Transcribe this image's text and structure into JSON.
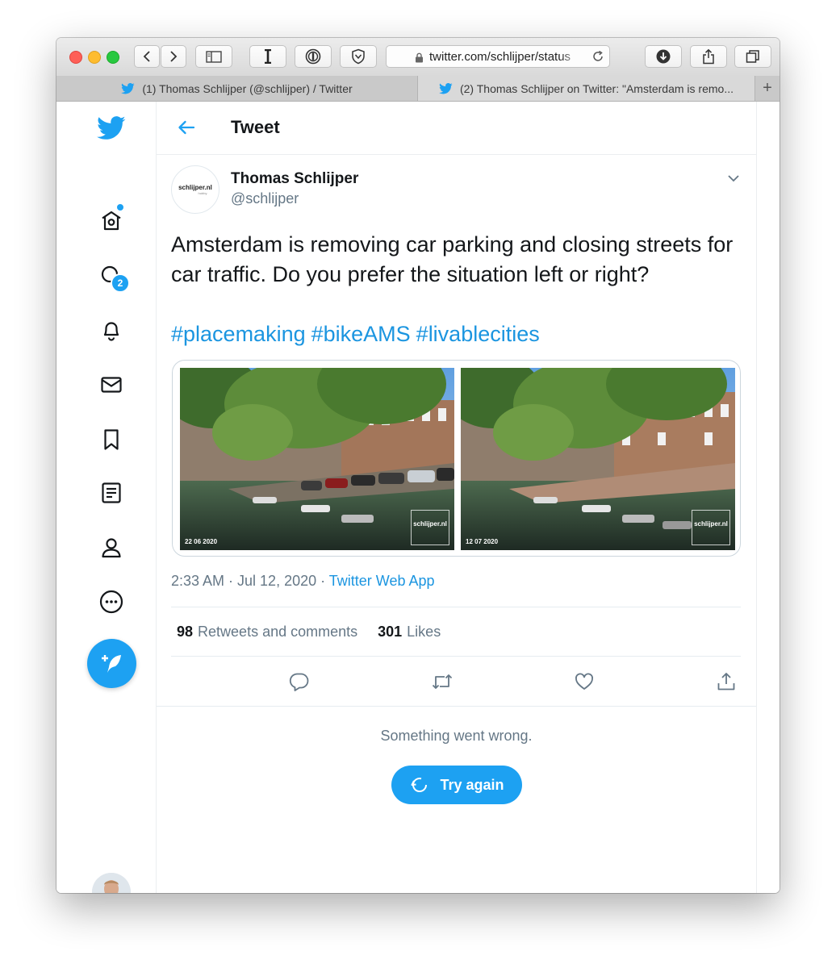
{
  "browser": {
    "url": "twitter.com/schlijper/status",
    "tabs": [
      {
        "label": "(1) Thomas Schlijper (@schlijper) / Twitter"
      },
      {
        "label": "(2) Thomas Schlijper on Twitter: \"Amsterdam is remo..."
      }
    ],
    "new_tab": "+"
  },
  "sidebar": {
    "notifications_count": "2",
    "icons": [
      "twitter-logo",
      "home",
      "explore",
      "notifications",
      "messages",
      "bookmarks",
      "lists",
      "profile",
      "more"
    ]
  },
  "header": {
    "title": "Tweet"
  },
  "tweet": {
    "author_name": "Thomas Schlijper",
    "author_handle": "@schlijper",
    "profile_logo": "schlijper.nl",
    "profile_logo_sub": "hobby",
    "text": "Amsterdam is removing car parking and closing streets for car traffic. Do you prefer the situation left or right?",
    "hashtags": [
      "#placemaking",
      "#bikeAMS",
      "#livablecities"
    ],
    "photos": [
      {
        "date": "22 06 2020",
        "watermark": "schlijper.nl"
      },
      {
        "date": "12 07 2020",
        "watermark": "schlijper.nl"
      }
    ],
    "timestamp": "2:33 AM · Jul 12, 2020 · ",
    "via": "Twitter Web App",
    "retweets_count": "98",
    "retweets_label": "Retweets and comments",
    "likes_count": "301",
    "likes_label": "Likes"
  },
  "error": {
    "message": "Something went wrong.",
    "retry_label": "Try again"
  },
  "colors": {
    "accent": "#1da1f2",
    "link": "#1b95e0",
    "text": "#14171a",
    "muted": "#657786"
  }
}
